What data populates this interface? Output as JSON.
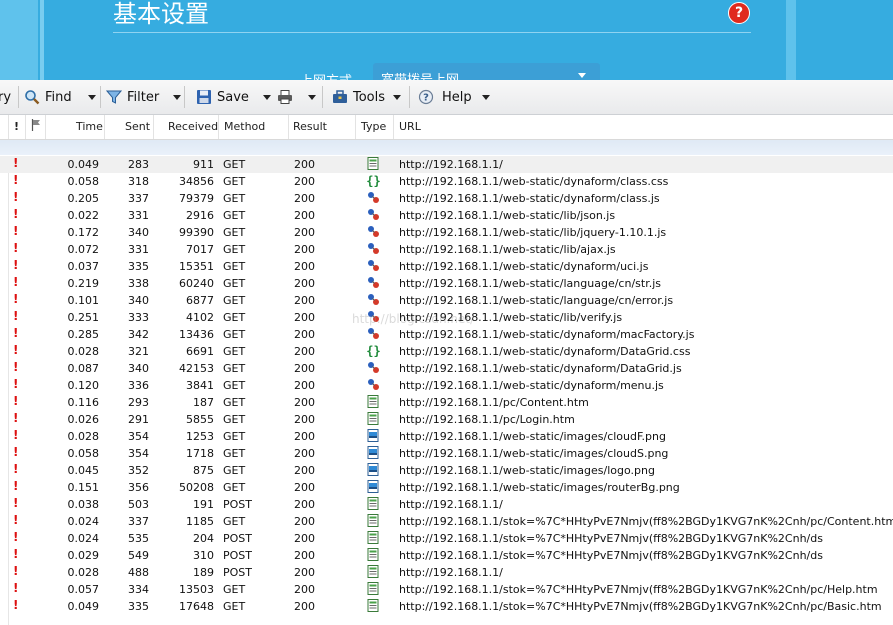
{
  "background_page": {
    "title": "基本设置",
    "help_icon": "?",
    "field_label": "上网方式",
    "field_value": "宽带拨号上网"
  },
  "toolbar": {
    "items": [
      {
        "label": "ry",
        "icon": "none"
      },
      {
        "label": "Find",
        "icon": "magnifier-icon"
      },
      {
        "label": "Filter",
        "icon": "funnel-icon"
      },
      {
        "label": "Save",
        "icon": "floppy-icon"
      },
      {
        "label": "",
        "icon": "printer-icon"
      },
      {
        "label": "Tools",
        "icon": "toolbox-icon"
      },
      {
        "label": "Help",
        "icon": "help-icon"
      }
    ]
  },
  "columns": {
    "excl": "!",
    "time": "Time",
    "sent": "Sent",
    "received": "Received",
    "method": "Method",
    "result": "Result",
    "type": "Type",
    "url": "URL"
  },
  "watermark": "http://blog.csdn.net/",
  "rows": [
    {
      "time": "0.049",
      "sent": "283",
      "received": "911",
      "method": "GET",
      "result": "200",
      "type": "html",
      "url": "http://192.168.1.1/"
    },
    {
      "time": "0.058",
      "sent": "318",
      "received": "34856",
      "method": "GET",
      "result": "200",
      "type": "css",
      "url": "http://192.168.1.1/web-static/dynaform/class.css"
    },
    {
      "time": "0.205",
      "sent": "337",
      "received": "79379",
      "method": "GET",
      "result": "200",
      "type": "js",
      "url": "http://192.168.1.1/web-static/dynaform/class.js"
    },
    {
      "time": "0.022",
      "sent": "331",
      "received": "2916",
      "method": "GET",
      "result": "200",
      "type": "js",
      "url": "http://192.168.1.1/web-static/lib/json.js"
    },
    {
      "time": "0.172",
      "sent": "340",
      "received": "99390",
      "method": "GET",
      "result": "200",
      "type": "js",
      "url": "http://192.168.1.1/web-static/lib/jquery-1.10.1.js"
    },
    {
      "time": "0.072",
      "sent": "331",
      "received": "7017",
      "method": "GET",
      "result": "200",
      "type": "js",
      "url": "http://192.168.1.1/web-static/lib/ajax.js"
    },
    {
      "time": "0.037",
      "sent": "335",
      "received": "15351",
      "method": "GET",
      "result": "200",
      "type": "js",
      "url": "http://192.168.1.1/web-static/dynaform/uci.js"
    },
    {
      "time": "0.219",
      "sent": "338",
      "received": "60240",
      "method": "GET",
      "result": "200",
      "type": "js",
      "url": "http://192.168.1.1/web-static/language/cn/str.js"
    },
    {
      "time": "0.101",
      "sent": "340",
      "received": "6877",
      "method": "GET",
      "result": "200",
      "type": "js",
      "url": "http://192.168.1.1/web-static/language/cn/error.js"
    },
    {
      "time": "0.251",
      "sent": "333",
      "received": "4102",
      "method": "GET",
      "result": "200",
      "type": "js",
      "url": "http://192.168.1.1/web-static/lib/verify.js"
    },
    {
      "time": "0.285",
      "sent": "342",
      "received": "13436",
      "method": "GET",
      "result": "200",
      "type": "js",
      "url": "http://192.168.1.1/web-static/dynaform/macFactory.js"
    },
    {
      "time": "0.028",
      "sent": "321",
      "received": "6691",
      "method": "GET",
      "result": "200",
      "type": "css",
      "url": "http://192.168.1.1/web-static/dynaform/DataGrid.css"
    },
    {
      "time": "0.087",
      "sent": "340",
      "received": "42153",
      "method": "GET",
      "result": "200",
      "type": "js",
      "url": "http://192.168.1.1/web-static/dynaform/DataGrid.js"
    },
    {
      "time": "0.120",
      "sent": "336",
      "received": "3841",
      "method": "GET",
      "result": "200",
      "type": "js",
      "url": "http://192.168.1.1/web-static/dynaform/menu.js"
    },
    {
      "time": "0.116",
      "sent": "293",
      "received": "187",
      "method": "GET",
      "result": "200",
      "type": "html",
      "url": "http://192.168.1.1/pc/Content.htm"
    },
    {
      "time": "0.026",
      "sent": "291",
      "received": "5855",
      "method": "GET",
      "result": "200",
      "type": "html",
      "url": "http://192.168.1.1/pc/Login.htm"
    },
    {
      "time": "0.028",
      "sent": "354",
      "received": "1253",
      "method": "GET",
      "result": "200",
      "type": "img",
      "url": "http://192.168.1.1/web-static/images/cloudF.png"
    },
    {
      "time": "0.058",
      "sent": "354",
      "received": "1718",
      "method": "GET",
      "result": "200",
      "type": "img",
      "url": "http://192.168.1.1/web-static/images/cloudS.png"
    },
    {
      "time": "0.045",
      "sent": "352",
      "received": "875",
      "method": "GET",
      "result": "200",
      "type": "img",
      "url": "http://192.168.1.1/web-static/images/logo.png"
    },
    {
      "time": "0.151",
      "sent": "356",
      "received": "50208",
      "method": "GET",
      "result": "200",
      "type": "img",
      "url": "http://192.168.1.1/web-static/images/routerBg.png"
    },
    {
      "time": "0.038",
      "sent": "503",
      "received": "191",
      "method": "POST",
      "result": "200",
      "type": "html",
      "url": "http://192.168.1.1/"
    },
    {
      "time": "0.024",
      "sent": "337",
      "received": "1185",
      "method": "GET",
      "result": "200",
      "type": "html",
      "url": "http://192.168.1.1/stok=%7C*HHtyPvE7Nmjv(ff8%2BGDy1KVG7nK%2Cnh/pc/Content.htm"
    },
    {
      "time": "0.024",
      "sent": "535",
      "received": "204",
      "method": "POST",
      "result": "200",
      "type": "html",
      "url": "http://192.168.1.1/stok=%7C*HHtyPvE7Nmjv(ff8%2BGDy1KVG7nK%2Cnh/ds"
    },
    {
      "time": "0.029",
      "sent": "549",
      "received": "310",
      "method": "POST",
      "result": "200",
      "type": "html",
      "url": "http://192.168.1.1/stok=%7C*HHtyPvE7Nmjv(ff8%2BGDy1KVG7nK%2Cnh/ds"
    },
    {
      "time": "0.028",
      "sent": "488",
      "received": "189",
      "method": "POST",
      "result": "200",
      "type": "html",
      "url": "http://192.168.1.1/"
    },
    {
      "time": "0.057",
      "sent": "334",
      "received": "13503",
      "method": "GET",
      "result": "200",
      "type": "html",
      "url": "http://192.168.1.1/stok=%7C*HHtyPvE7Nmjv(ff8%2BGDy1KVG7nK%2Cnh/pc/Help.htm"
    },
    {
      "time": "0.049",
      "sent": "335",
      "received": "17648",
      "method": "GET",
      "result": "200",
      "type": "html",
      "url": "http://192.168.1.1/stok=%7C*HHtyPvE7Nmjv(ff8%2BGDy1KVG7nK%2Cnh/pc/Basic.htm"
    }
  ]
}
